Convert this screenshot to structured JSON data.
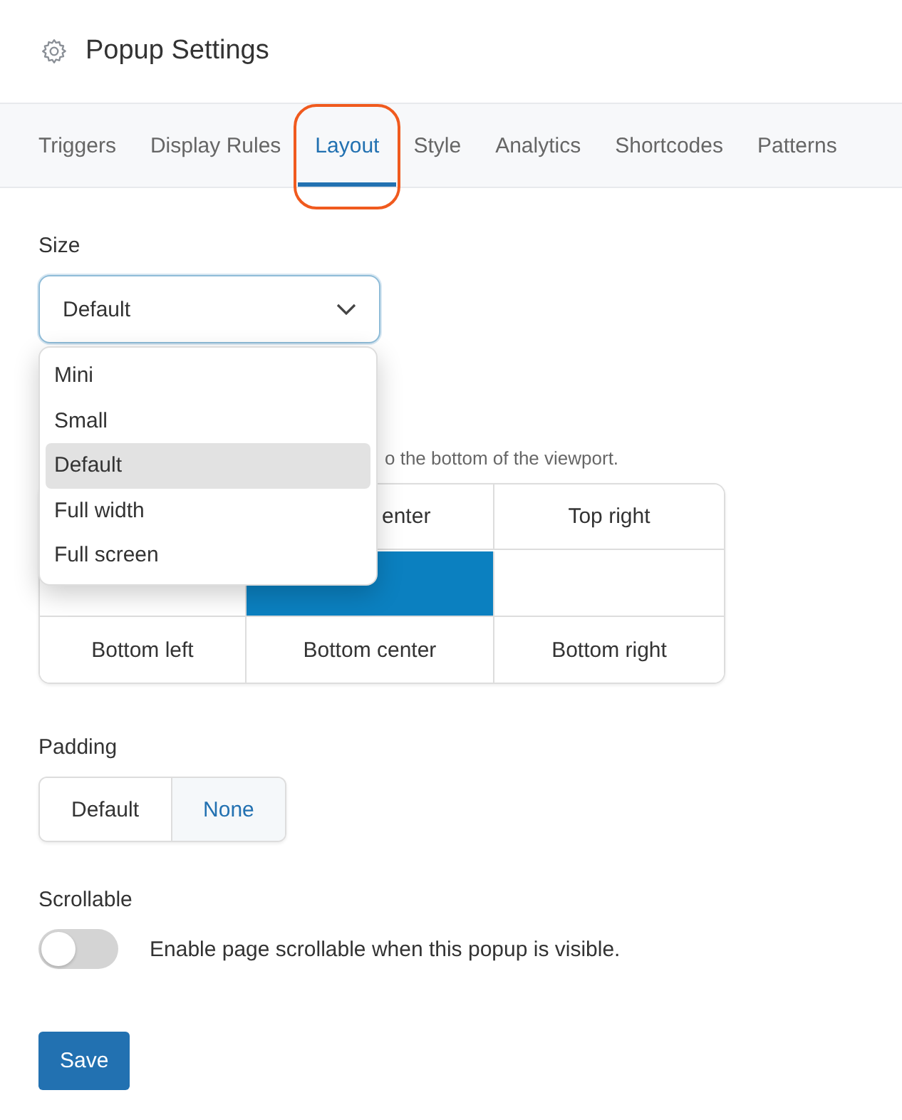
{
  "header": {
    "title": "Popup Settings"
  },
  "tabs": [
    {
      "label": "Triggers",
      "selected": false,
      "circled": false
    },
    {
      "label": "Display Rules",
      "selected": false,
      "circled": false
    },
    {
      "label": "Layout",
      "selected": true,
      "circled": true
    },
    {
      "label": "Style",
      "selected": false,
      "circled": false
    },
    {
      "label": "Analytics",
      "selected": false,
      "circled": false
    },
    {
      "label": "Shortcodes",
      "selected": false,
      "circled": false
    },
    {
      "label": "Patterns",
      "selected": false,
      "circled": false
    }
  ],
  "size": {
    "label": "Size",
    "value": "Default",
    "expanded": true,
    "options": [
      {
        "label": "Mini",
        "selected": false
      },
      {
        "label": "Small",
        "selected": false
      },
      {
        "label": "Default",
        "selected": true
      },
      {
        "label": "Full width",
        "selected": false
      },
      {
        "label": "Full screen",
        "selected": false
      }
    ]
  },
  "position": {
    "hint": "o the bottom of the viewport.",
    "cells": [
      {
        "label": "enter",
        "selected": false
      },
      {
        "label": "Top right",
        "selected": false
      },
      {
        "selected": false
      },
      {
        "selected": true
      },
      {
        "selected": false
      },
      {
        "label": "Bottom left",
        "selected": false
      },
      {
        "label": "Bottom center",
        "selected": false
      },
      {
        "label": "Bottom right",
        "selected": false
      }
    ]
  },
  "padding": {
    "label": "Padding",
    "options": [
      {
        "label": "Default",
        "selected": false
      },
      {
        "label": "None",
        "selected": true
      }
    ]
  },
  "scrollable": {
    "label": "Scrollable",
    "on": false,
    "text": "Enable page scrollable when this popup is visible."
  },
  "save_button": "Save"
}
